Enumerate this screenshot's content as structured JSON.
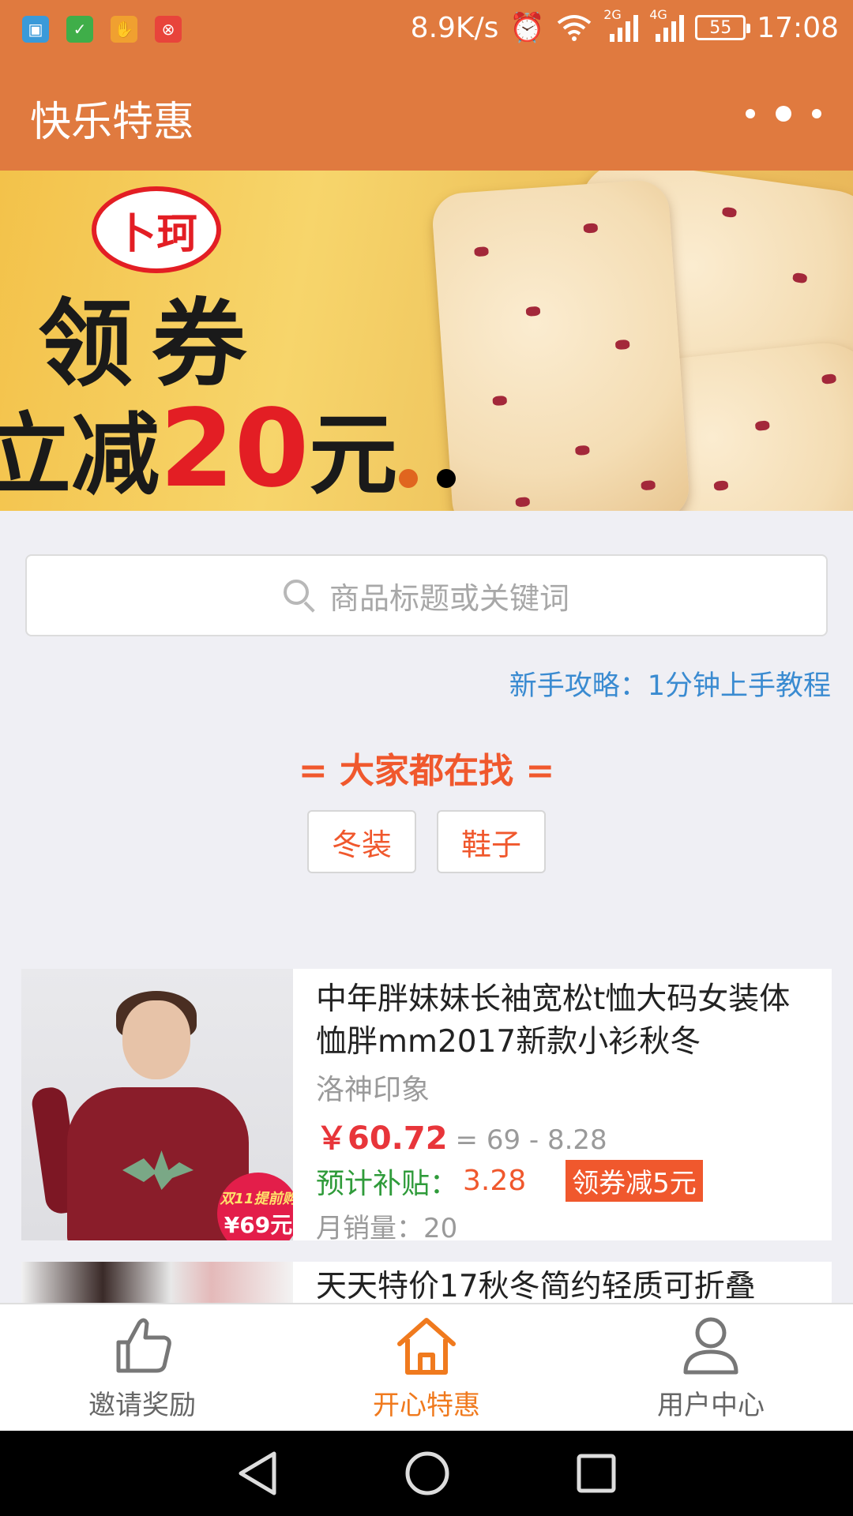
{
  "status_bar": {
    "speed": "8.9K/s",
    "sig1_label": "2G",
    "sig2_label": "4G",
    "battery": "55",
    "time": "17:08"
  },
  "header": {
    "title": "快乐特惠"
  },
  "banner": {
    "logo_text": "卜珂",
    "line1": "领券",
    "line2_prefix": "立减",
    "line2_amount": "20",
    "line2_suffix": "元",
    "slides": 2,
    "active_slide": 0
  },
  "search": {
    "placeholder": "商品标题或关键词"
  },
  "guide_link": "新手攻略：1分钟上手教程",
  "hot": {
    "title": "= 大家都在找 =",
    "tags": [
      "冬装",
      "鞋子"
    ]
  },
  "products": [
    {
      "title": "中年胖妹妹长袖宽松t恤大码女装体恤胖mm2017新款小衫秋冬",
      "shop": "洛神印象",
      "price": "￥60.72",
      "price_calc": "= 69 - 8.28",
      "subsidy_label": "预计补贴：",
      "subsidy_value": "3.28",
      "coupon": "领券减5元",
      "sales": "月销量：20",
      "sticker_top": "双11提前购",
      "sticker_price": "¥69元"
    },
    {
      "title": "天天特价17秋冬简约轻质可折叠"
    }
  ],
  "tabbar": {
    "items": [
      {
        "label": "邀请奖励",
        "icon": "thumbs-up-icon"
      },
      {
        "label": "开心特惠",
        "icon": "home-icon"
      },
      {
        "label": "用户中心",
        "icon": "user-icon"
      }
    ],
    "active": 1,
    "active_color": "#f07a1e"
  },
  "colors": {
    "brand": "#e07a3f",
    "accent": "#f0582d",
    "link": "#3a8bd1"
  }
}
